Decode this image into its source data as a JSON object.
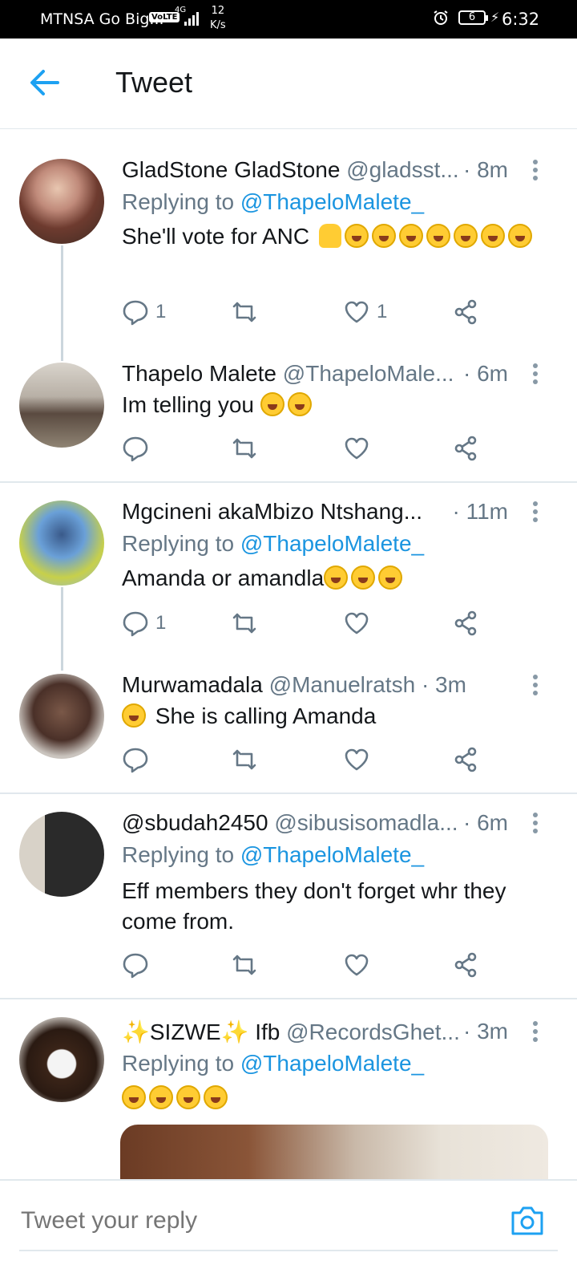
{
  "status_bar": {
    "carrier": "MTNSA Go Big...",
    "volte": "VoLTE",
    "network": "4G",
    "speed_value": "12",
    "speed_unit": "K/s",
    "battery": "6",
    "time": "6:32"
  },
  "header": {
    "title": "Tweet"
  },
  "tweets": [
    {
      "name": "GladStone GladStone",
      "handle": "@gladsst...",
      "time": "· 8m",
      "replying_label": "Replying to",
      "replying_to": "@ThapeloMalete_",
      "text": "She'll vote for ANC",
      "reply_count": "1",
      "like_count": "1"
    },
    {
      "name": "Thapelo Malete",
      "handle": "@ThapeloMale...",
      "time": "· 6m",
      "text": "Im telling you"
    },
    {
      "name": "Mgcineni akaMbizo Ntshang...",
      "time": "· 11m",
      "replying_label": "Replying to",
      "replying_to": "@ThapeloMalete_",
      "text": "Amanda or amandla",
      "reply_count": "1"
    },
    {
      "name": "Murwamadala",
      "handle": "@Manuelratsh",
      "time": "· 3m",
      "text": "She is calling Amanda"
    },
    {
      "name": "@sbudah2450",
      "handle": "@sibusisomadla...",
      "time": "· 6m",
      "replying_label": "Replying to",
      "replying_to": "@ThapeloMalete_",
      "text": "Eff members they don't forget whr they come from."
    },
    {
      "name": "SIZWE",
      "name_suffix": "Ifb",
      "handle": "@RecordsGhet...",
      "time": "· 3m",
      "replying_label": "Replying to",
      "replying_to": "@ThapeloMalete_"
    }
  ],
  "reply_bar": {
    "placeholder": "Tweet your reply"
  },
  "colors": {
    "accent": "#1da1f2",
    "mention": "#1b95e0",
    "secondary_text": "#657786",
    "divider": "#e1e8ed"
  },
  "icons": [
    "back-arrow-icon",
    "more-icon",
    "reply-icon",
    "retweet-icon",
    "like-icon",
    "share-icon",
    "camera-icon",
    "alarm-icon",
    "battery-icon",
    "sparkle-icon"
  ]
}
